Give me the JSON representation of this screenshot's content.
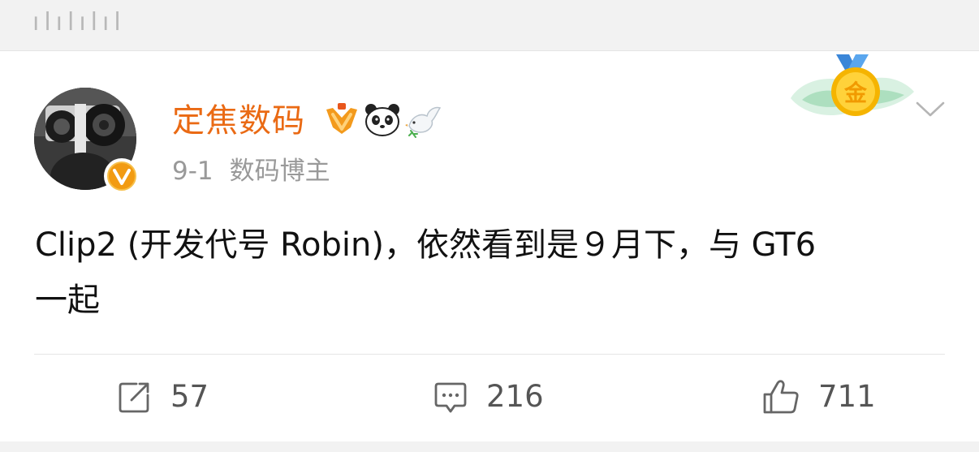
{
  "top_strip": {
    "clipped_text": "ılılılıl"
  },
  "post": {
    "author": {
      "name": "定焦数码",
      "badge_icons": [
        "vip-crown-icon",
        "panda-icon",
        "dove-icon"
      ]
    },
    "date": "9-1",
    "source": "数码博主",
    "text_line1": "Clip2 (开发代号 Robin)，依然看到是９月下，与 GT6",
    "text_line2": "一起",
    "medal_label": "金"
  },
  "actions": {
    "repost_count": "57",
    "comment_count": "216",
    "like_count": "711"
  },
  "colors": {
    "author_name": "#ea6a14",
    "meta_text": "#999999",
    "body_text": "#111111",
    "icon_gray": "#666666",
    "verified_orange": "#f29b12"
  }
}
